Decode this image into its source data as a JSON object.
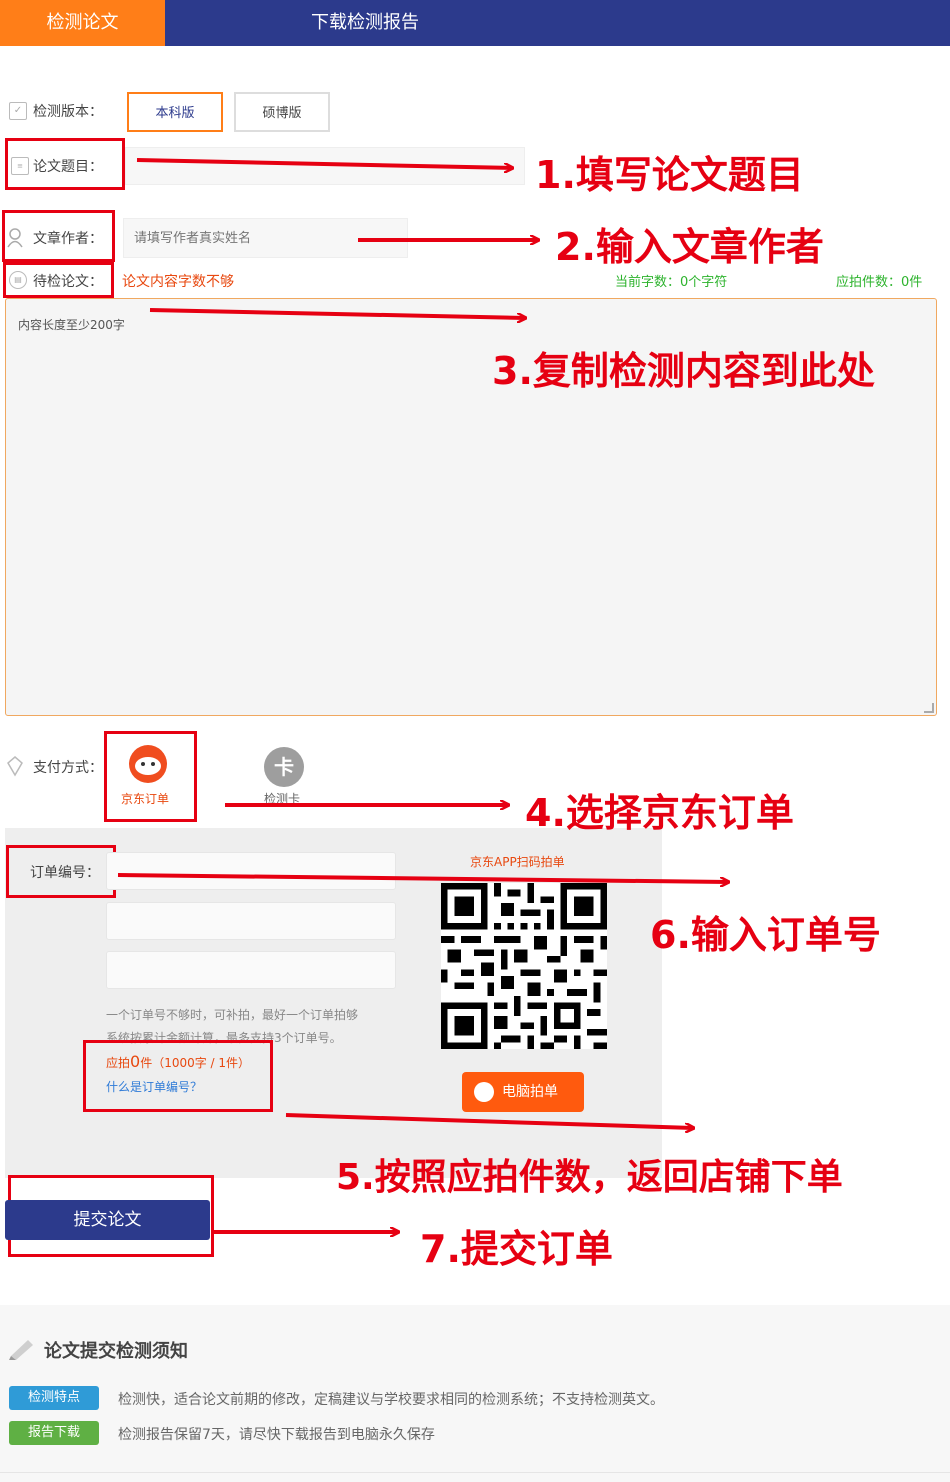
{
  "nav": {
    "tab_check": "检测论文",
    "tab_download": "下载检测报告"
  },
  "form": {
    "version_label": "检测版本：",
    "version_bachelor": "本科版",
    "version_master": "硕博版",
    "title_label": "论文题目：",
    "author_label": "文章作者：",
    "author_placeholder": "请填写作者真实姓名",
    "paper_label": "待检论文：",
    "paper_warning": "论文内容字数不够",
    "char_count": "当前字数：0个字符",
    "item_count": "应拍件数：0件",
    "content_placeholder": "内容长度至少200字"
  },
  "payment": {
    "label": "支付方式：",
    "jd_label": "京东订单",
    "card_label": "检测卡",
    "card_icon_char": "卡",
    "order_label": "订单编号：",
    "scan_title": "京东APP扫码拍单",
    "hint_line1": "一个订单号不够时，可补拍，最好一个订单拍够",
    "hint_line2": "系统按累计金额计算，最多支持3个订单号。",
    "should_buy_prefix": "应拍",
    "should_buy_count": "0",
    "should_buy_suffix": "件（1000字 / 1件）",
    "what_is_order": "什么是订单编号？",
    "pc_order_button": "电脑拍单"
  },
  "submit_label": "提交论文",
  "annotations": {
    "step1": "1.填写论文题目",
    "step2": "2.输入文章作者",
    "step3": "3.复制检测内容到此处",
    "step4": "4.选择京东订单",
    "step5": "5.按照应拍件数，返回店铺下单",
    "step6": "6.输入订单号",
    "step7": "7.提交订单"
  },
  "notice": {
    "title": "论文提交检测须知",
    "tag1": "检测特点",
    "text1": "检测快，适合论文前期的修改，定稿建议与学校要求相同的检测系统；不支持检测英文。",
    "tag2": "报告下载",
    "text2": "检测报告保留7天，请尽快下载报告到电脑永久保存"
  },
  "colors": {
    "nav_bg": "#2c3a8c",
    "accent_orange": "#ff7e18",
    "annotation_red": "#e60012",
    "count_green": "#2db32d",
    "tag_blue": "#2f9bd7",
    "tag_green": "#5fb044"
  },
  "icons": [
    "checkbox-icon",
    "title-icon",
    "user-icon",
    "document-icon",
    "payment-icon",
    "jd-mascot-icon",
    "card-icon",
    "qr-code",
    "pencil-icon"
  ]
}
